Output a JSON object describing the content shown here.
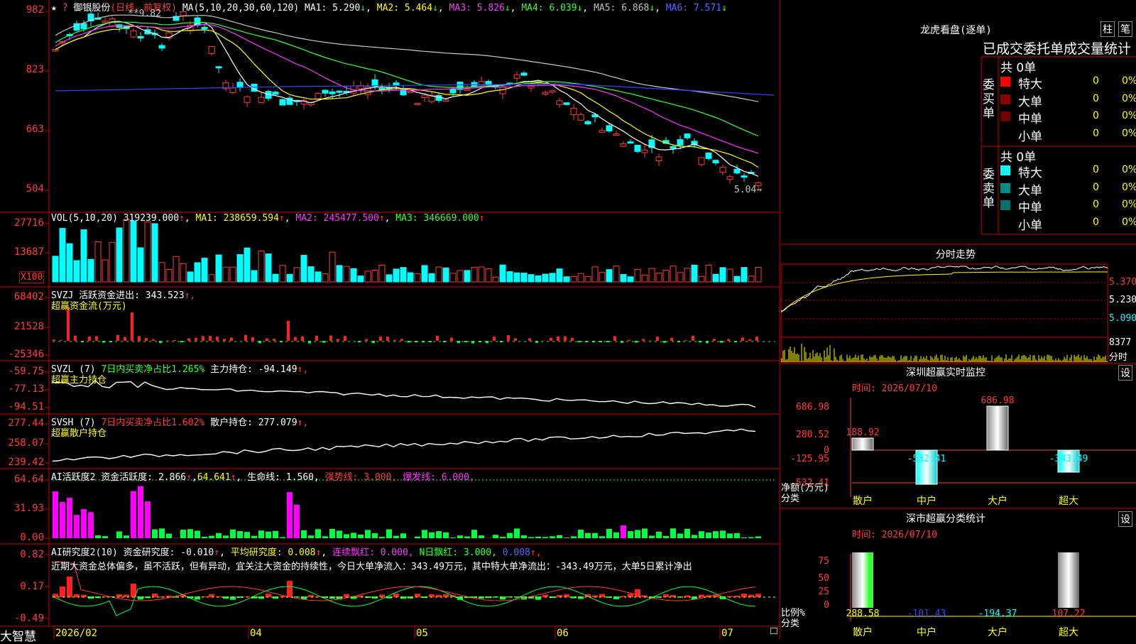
{
  "stock": {
    "stars": "★ ",
    "marker": "?",
    "name": "御银股份",
    "period": "(日线，前复权)"
  },
  "ma_header": {
    "params": "MA(5,10,20,30,60,120)",
    "ma1": "MA1: 5.290",
    "ma2": "MA2: 5.464",
    "ma3": "MA3: 5.826",
    "ma4": "MA4: 6.039",
    "ma5": "MA5: 6.868",
    "ma6": "MA6: 7.571",
    "arrow": "↓"
  },
  "price_axis": {
    "labels": [
      "982",
      "823",
      "663",
      "504"
    ]
  },
  "price_notes": {
    "high": "**9.82",
    "low": "5.04→"
  },
  "vol_header": {
    "label": "VOL(5,10,20)",
    "val": "319239.000",
    "ma1": "MA1: 238659.594",
    "ma2": "MA2: 245477.500",
    "ma3": "MA3: 346669.000",
    "up": "↑"
  },
  "vol_axis": {
    "labels": [
      "27716",
      "13687"
    ],
    "unit": "X100"
  },
  "svzj": {
    "title": "SVZJ  活跃资金进出: 343.523",
    "up": "↑,",
    "sub": "超赢资金流(万元)",
    "axis": [
      "68402",
      "21528",
      "-25346"
    ]
  },
  "svzl": {
    "pre": "SVZL (7)",
    "mid": "7日内买卖净占比1.265%",
    "post": " 主力持仓: -94.149",
    "up": "↑,",
    "sub": "超赢主力持仓",
    "axis": [
      "-59.75",
      "-77.13",
      "-94.51"
    ]
  },
  "svsh": {
    "pre": "SVSH (7)",
    "mid": "7日内买卖净占比1.602%",
    "post": " 散户持仓: 277.079",
    "up": "↑,",
    "sub": "超赢散户持仓",
    "axis": [
      "277.44",
      "258.07",
      "239.42"
    ]
  },
  "ai_act": {
    "pre": "AI活跃度2 资金活跃度: 2.866",
    "v2": "64.641",
    "life": " 生命线: 1.560,",
    "strong": "强势线: 3.000,",
    "burst": "爆发线: 6.000,",
    "up": "↑",
    "axis": [
      "64.64",
      "31.93",
      "0.00"
    ]
  },
  "ai_res": {
    "pre": "AI研究度2(10) 资金研究度: -0.010",
    "avg": "平均研究度: 0.008",
    "lianxu": "连续飘红: 0.000,",
    "nday": "N日飘红: 3.000,",
    "last": "0.008",
    "up": "↑",
    "sep": ",",
    "text": "近期大资金总体偏多，虽不活跃，但有异动，宜关注大资金的持续性，今日大单净流入：343.49万元，其中特大单净流出：-343.49万元，大单5日累计净出",
    "axis": [
      "0.82",
      "0.17",
      "-0.49"
    ]
  },
  "dates": {
    "labels": [
      "2026/02",
      "04",
      "05",
      "06",
      "07"
    ]
  },
  "brand": "大智慧",
  "panel_lhb": {
    "title": "龙虎看盘(逐单)",
    "btn_zhu": "柱",
    "btn_bi": "笔",
    "sub": "已成交委托单成交量统计",
    "buy_label": "委买单",
    "sell_label": "委卖单",
    "buy_total": "共 0单",
    "sell_total": "共 0单",
    "buy_rows": [
      {
        "name": "特大",
        "v": "0",
        "p": "0%",
        "color": "#ff0000"
      },
      {
        "name": "大单",
        "v": "0",
        "p": "0%",
        "color": "#8b0000"
      },
      {
        "name": "中单",
        "v": "0",
        "p": "0%",
        "color": "#700000"
      },
      {
        "name": "小单",
        "v": "0",
        "p": "0%",
        "color": "#000000"
      }
    ],
    "sell_rows": [
      {
        "name": "特大",
        "v": "0",
        "p": "0%",
        "color": "#00ffff"
      },
      {
        "name": "大单",
        "v": "0",
        "p": "0%",
        "color": "#008b8b"
      },
      {
        "name": "中单",
        "v": "0",
        "p": "0%",
        "color": "#007070"
      },
      {
        "name": "小单",
        "v": "0",
        "p": "0%",
        "color": "#000000"
      }
    ]
  },
  "panel_fs": {
    "title": "分时走势",
    "axis": [
      "5.370",
      "5.230",
      "5.090"
    ],
    "vol_label": "8377",
    "unit": "分时"
  },
  "panel_sz": {
    "title": "深圳超赢实时监控",
    "btn": "设",
    "time": "时间: 2026/07/10",
    "axis": [
      "686.98",
      "280.52",
      "0",
      "-125.95",
      "-532.41"
    ],
    "ylab1": "净额(万元)",
    "ylab2": "分类",
    "bars": [
      {
        "cat": "散户",
        "val": "188.92"
      },
      {
        "cat": "中户",
        "val": "-532.41"
      },
      {
        "cat": "大户",
        "val": "686.98"
      },
      {
        "cat": "超大",
        "val": "-343.49"
      }
    ]
  },
  "panel_fl": {
    "title": "深市超赢分类统计",
    "btn": "设",
    "time": "时间: 2026/07/10",
    "axis": [
      "75",
      "50",
      "25",
      "0"
    ],
    "ylab1": "比例%",
    "ylab2": "分类",
    "bars": [
      {
        "cat": "散户",
        "val": "288.58"
      },
      {
        "cat": "中户",
        "val": "-101.43"
      },
      {
        "cat": "大户",
        "val": "-194.37"
      },
      {
        "cat": "超大",
        "val": "107.22"
      }
    ]
  }
}
